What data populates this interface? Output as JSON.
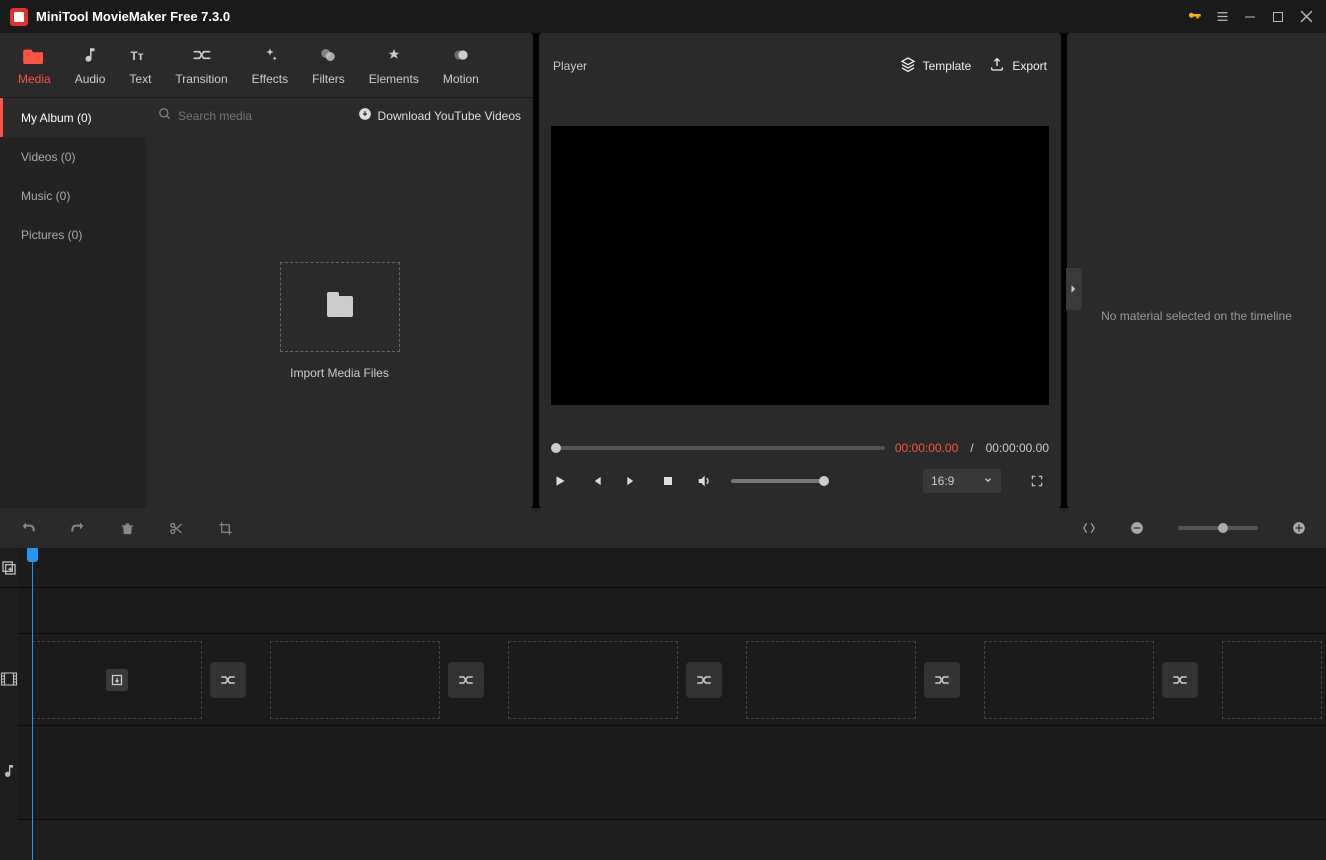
{
  "app": {
    "title": "MiniTool MovieMaker Free 7.3.0"
  },
  "toolTabs": [
    {
      "label": "Media"
    },
    {
      "label": "Audio"
    },
    {
      "label": "Text"
    },
    {
      "label": "Transition"
    },
    {
      "label": "Effects"
    },
    {
      "label": "Filters"
    },
    {
      "label": "Elements"
    },
    {
      "label": "Motion"
    }
  ],
  "sidebar": {
    "items": [
      {
        "label": "My Album (0)"
      },
      {
        "label": "Videos (0)"
      },
      {
        "label": "Music (0)"
      },
      {
        "label": "Pictures (0)"
      }
    ]
  },
  "media": {
    "searchPlaceholder": "Search media",
    "downloadLink": "Download YouTube Videos",
    "importLabel": "Import Media Files"
  },
  "player": {
    "title": "Player",
    "templateLabel": "Template",
    "exportLabel": "Export",
    "currentTime": "00:00:00.00",
    "separator": "/",
    "totalTime": "00:00:00.00",
    "aspect": "16:9"
  },
  "rightPanel": {
    "noSelection": "No material selected on the timeline"
  }
}
